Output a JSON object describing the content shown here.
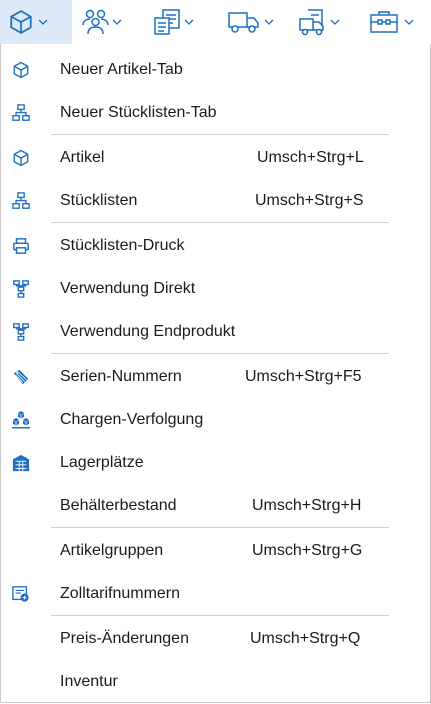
{
  "toolbar": {
    "buttons": [
      {
        "icon": "cube-icon",
        "active": true
      },
      {
        "icon": "users-icon"
      },
      {
        "icon": "structure-list-icon"
      },
      {
        "icon": "truck-icon"
      },
      {
        "icon": "delivery-note-icon"
      },
      {
        "icon": "toolbox-icon"
      }
    ]
  },
  "menu": {
    "items": [
      {
        "label": "Neuer Artikel-Tab",
        "shortcut": "",
        "icon": "cube-icon"
      },
      {
        "label": "Neuer Stücklisten-Tab",
        "shortcut": "",
        "icon": "hierarchy-icon"
      },
      {
        "label": "Artikel",
        "shortcut": "Umsch+Strg+L",
        "icon": "cube-icon"
      },
      {
        "label": "Stücklisten",
        "shortcut": "Umsch+Strg+S",
        "icon": "hierarchy-icon"
      },
      {
        "label": "Stücklisten-Druck",
        "shortcut": "",
        "icon": "printer-icon"
      },
      {
        "label": "Verwendung Direkt",
        "shortcut": "",
        "icon": "usage-tree-icon"
      },
      {
        "label": "Verwendung Endprodukt",
        "shortcut": "",
        "icon": "usage-tree-icon"
      },
      {
        "label": "Serien-Nummern",
        "shortcut": "Umsch+Strg+F5",
        "icon": "tags-icon"
      },
      {
        "label": "Chargen-Verfolgung",
        "shortcut": "",
        "icon": "batch-boxes-icon"
      },
      {
        "label": "Lagerplätze",
        "shortcut": "",
        "icon": "warehouse-shelf-icon"
      },
      {
        "label": "Behälterbestand",
        "shortcut": "Umsch+Strg+H",
        "icon": ""
      },
      {
        "label": "Artikelgruppen",
        "shortcut": "Umsch+Strg+G",
        "icon": ""
      },
      {
        "label": "Zolltarifnummern",
        "shortcut": "",
        "icon": "customs-tariff-icon"
      },
      {
        "label": "Preis-Änderungen",
        "shortcut": "Umsch+Strg+Q",
        "icon": ""
      },
      {
        "label": "Inventur",
        "shortcut": "",
        "icon": ""
      }
    ]
  },
  "colors": {
    "accent": "#1e6fbf",
    "active_bg": "#dce9f7",
    "separator": "#d0d0d0",
    "text": "#1b1b1b"
  }
}
